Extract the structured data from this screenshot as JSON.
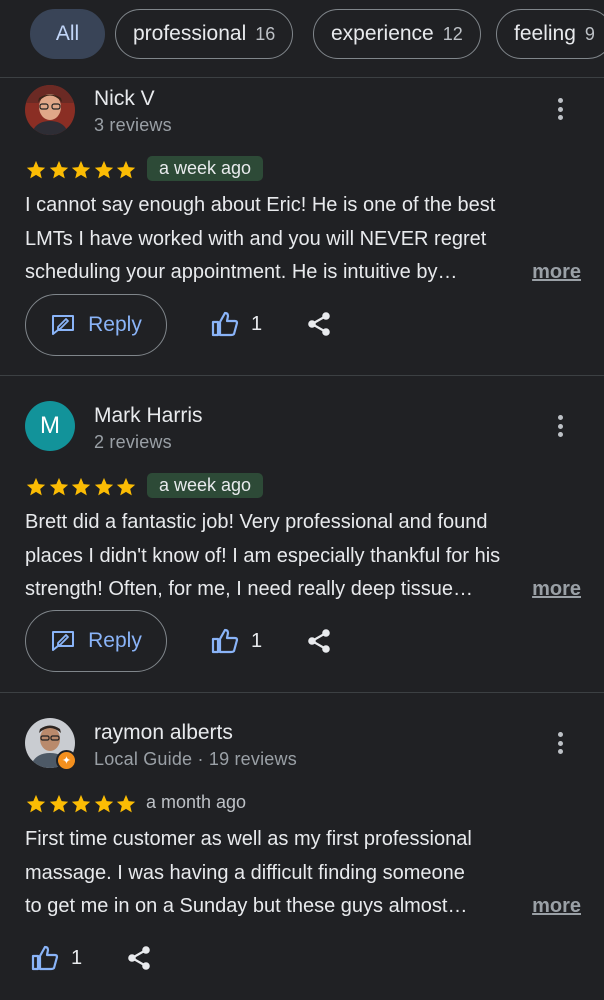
{
  "filters": [
    {
      "label": "All",
      "count": "",
      "selected": true
    },
    {
      "label": "professional",
      "count": "16"
    },
    {
      "label": "experience",
      "count": "12"
    },
    {
      "label": "feeling",
      "count": "9"
    }
  ],
  "reviews": [
    {
      "name": "Nick V",
      "meta": "3 reviews",
      "rating": 5,
      "date": "a week ago",
      "lines": [
        "I cannot say enough about Eric!  He is one of the best",
        "LMTs I have worked with and you will NEVER regret",
        "scheduling your appointment.  He is intuitive by…"
      ],
      "more": "more",
      "reply": "Reply",
      "likes": "1"
    },
    {
      "name": "Mark Harris",
      "avatar_letter": "M",
      "meta": "2 reviews",
      "rating": 5,
      "date": "a week ago",
      "lines": [
        "Brett did a fantastic job! Very professional and found",
        "places I didn't know of! I am especially thankful for his",
        "strength! Often, for me, I need really deep tissue…"
      ],
      "more": "more",
      "reply": "Reply",
      "likes": "1"
    },
    {
      "name": "raymon alberts",
      "meta": "Local Guide · 19 reviews",
      "rating": 5,
      "date": "a month ago",
      "lines": [
        "First time customer as well as my first professional",
        "massage.  I was having a difficult finding someone",
        "to get me in on a Sunday but these guys almost…"
      ],
      "more": "more",
      "likes": "1"
    }
  ],
  "colors": {
    "background": "#202124",
    "star": "#fbbc04",
    "accent": "#8ab4f8",
    "date_badge": "#2d4a37",
    "selected_chip": "#394457"
  }
}
